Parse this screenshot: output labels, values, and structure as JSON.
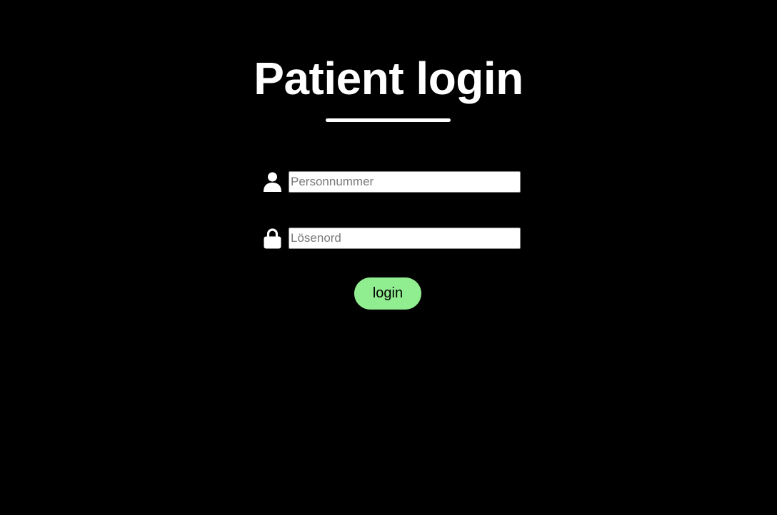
{
  "page": {
    "title": "Patient login"
  },
  "form": {
    "personnummer": {
      "icon": "user-icon",
      "placeholder": "Personnummer",
      "value": ""
    },
    "password": {
      "icon": "lock-icon",
      "placeholder": "Lösenord",
      "value": ""
    },
    "submit_label": "login"
  },
  "colors": {
    "background": "#000000",
    "text": "#ffffff",
    "button": "#90ee90"
  }
}
